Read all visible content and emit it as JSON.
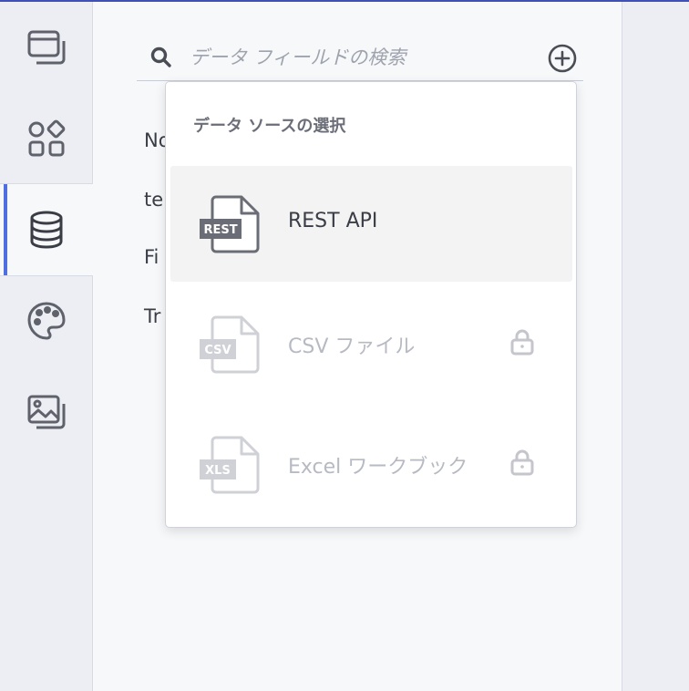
{
  "rail": {
    "items": [
      {
        "icon": "window-icon",
        "active": false
      },
      {
        "icon": "components-icon",
        "active": false
      },
      {
        "icon": "database-icon",
        "active": true
      },
      {
        "icon": "palette-icon",
        "active": false
      },
      {
        "icon": "images-icon",
        "active": false
      }
    ]
  },
  "search": {
    "placeholder": "データ フィールドの検索",
    "value": ""
  },
  "fields": [
    "No",
    "te",
    "Fi",
    "Tr"
  ],
  "dropdown": {
    "title": "データ ソースの選択",
    "options": [
      {
        "label": "REST API",
        "badge": "REST",
        "disabled": false,
        "locked": false
      },
      {
        "label": "CSV ファイル",
        "badge": "CSV",
        "disabled": true,
        "locked": true
      },
      {
        "label": "Excel ワークブック",
        "badge": "XLS",
        "disabled": true,
        "locked": true
      }
    ]
  },
  "colors": {
    "accent": "#4f6fe0",
    "top_border": "#3f51b5",
    "icon": "#5f626b",
    "disabled": "#c4c6cc"
  }
}
